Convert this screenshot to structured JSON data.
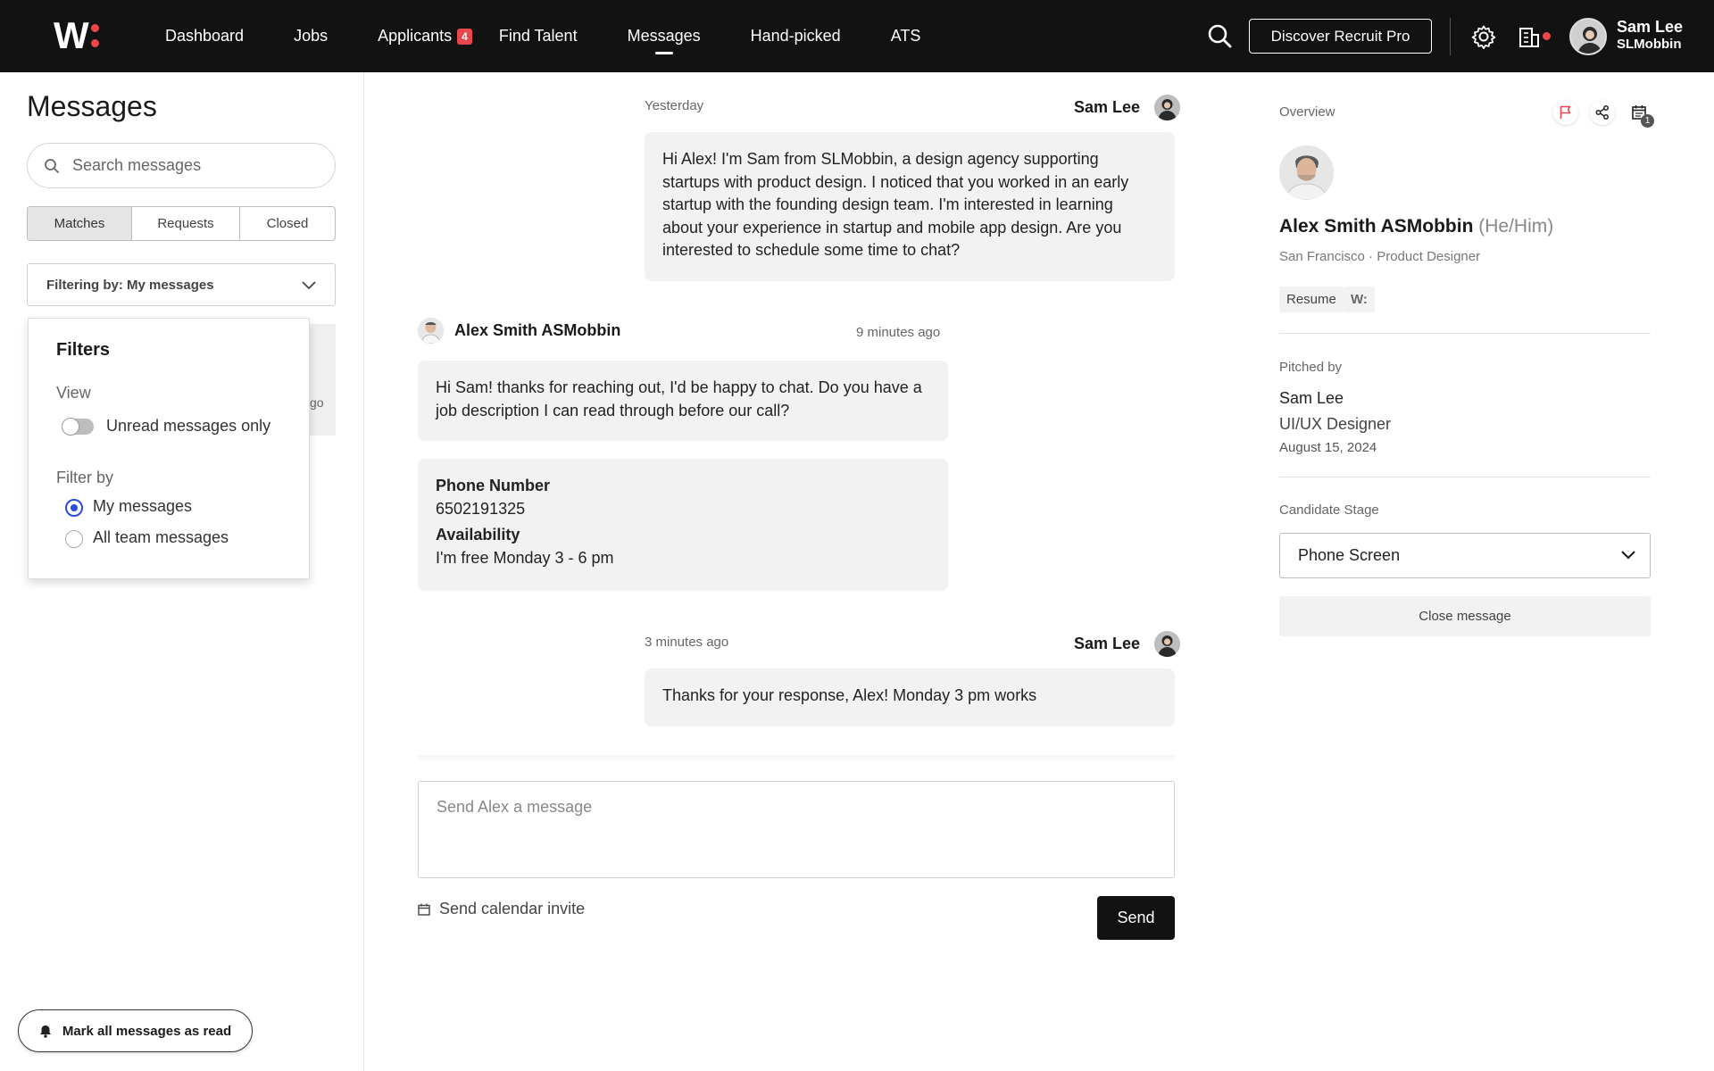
{
  "nav": {
    "logo": "W",
    "items": [
      {
        "label": "Dashboard"
      },
      {
        "label": "Jobs"
      },
      {
        "label": "Applicants",
        "badge": "4"
      },
      {
        "label": "Find Talent"
      },
      {
        "label": "Messages",
        "active": true
      },
      {
        "label": "Hand-picked"
      },
      {
        "label": "ATS"
      }
    ],
    "discover_label": "Discover Recruit Pro",
    "user_name": "Sam Lee",
    "user_company": "SLMobbin",
    "accent": "#e8484d"
  },
  "left": {
    "title": "Messages",
    "search_placeholder": "Search messages",
    "tabs": [
      "Matches",
      "Requests",
      "Closed"
    ],
    "active_tab": "Matches",
    "filter_select": "Filtering by: My messages",
    "list_ghost_text": "go",
    "filters": {
      "title": "Filters",
      "view_label": "View",
      "unread_label": "Unread messages only",
      "unread_on": false,
      "filter_by_label": "Filter by",
      "options": [
        "My messages",
        "All team messages"
      ],
      "selected": "My messages"
    },
    "mark_all_label": "Mark all messages as read"
  },
  "conversation": {
    "messages": [
      {
        "time": "Yesterday",
        "sender": "Sam Lee",
        "text": "Hi Alex! I'm Sam from SLMobbin, a design agency supporting startups with product design. I noticed that you worked in an early startup with the founding design team. I'm interested in learning about your experience in startup and mobile app design. Are you interested to schedule some time to chat?"
      },
      {
        "time": "9 minutes ago",
        "sender": "Alex Smith ASMobbin",
        "text": "Hi Sam! thanks for reaching out, I'd be happy to chat. Do you have a job description I can read through before our call?",
        "details": [
          {
            "label": "Phone Number",
            "value": "6502191325"
          },
          {
            "label": "Availability",
            "value": "I'm free Monday 3 - 6 pm"
          }
        ]
      },
      {
        "time": "3 minutes ago",
        "sender": "Sam Lee",
        "text": "Thanks for your response, Alex! Monday 3 pm works"
      }
    ],
    "compose_placeholder": "Send Alex a message",
    "calendar_invite_label": "Send calendar invite",
    "send_label": "Send"
  },
  "overview": {
    "label": "Overview",
    "calendar_count": "1",
    "name": "Alex Smith ASMobbin",
    "pronouns": "(He/Him)",
    "subtitle": "San Francisco · Product Designer",
    "tags": [
      "Resume",
      "W:"
    ],
    "pitched_by_label": "Pitched by",
    "pitched_name": "Sam Lee",
    "pitched_role": "UI/UX Designer",
    "pitched_date": "August 15, 2024",
    "stage_label": "Candidate Stage",
    "stage_value": "Phone Screen",
    "close_label": "Close message"
  }
}
